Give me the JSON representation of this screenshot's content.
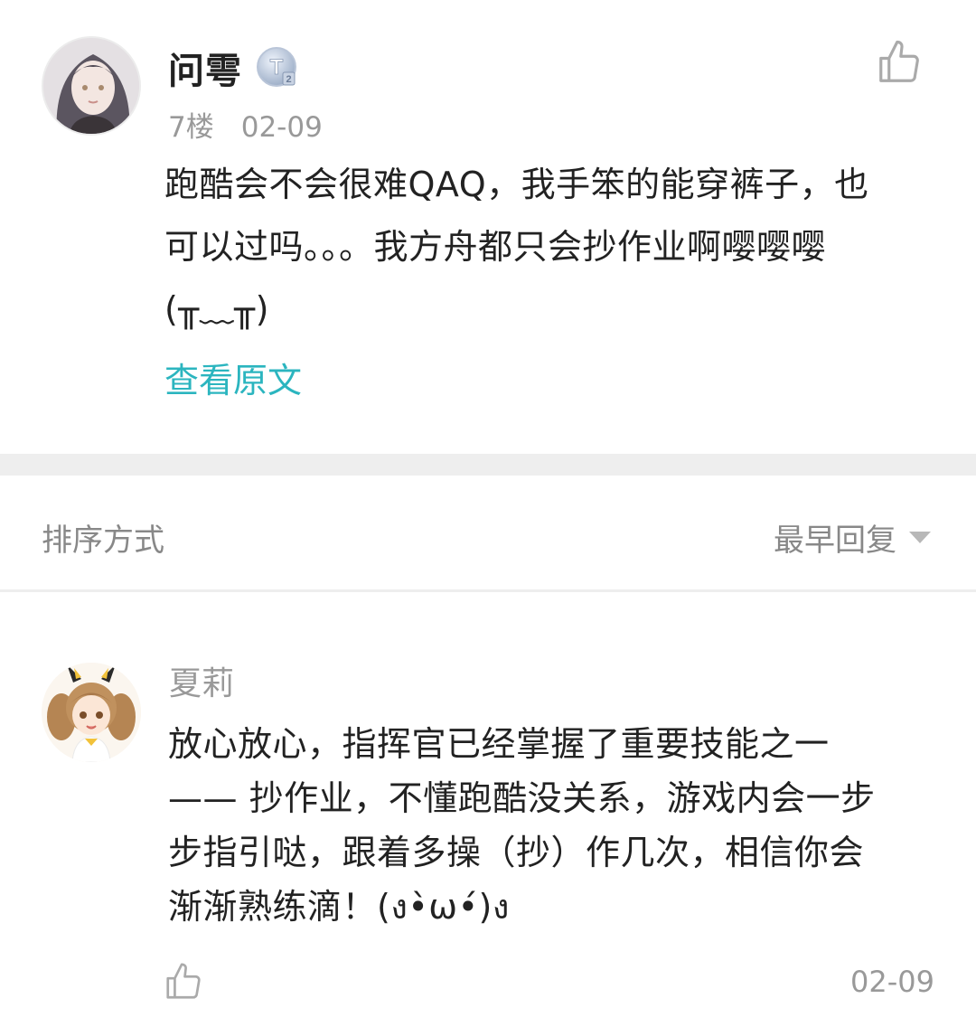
{
  "post": {
    "author": "问雩",
    "level_badge": "T2",
    "floor": "7楼",
    "date": "02-09",
    "body_lines": [
      "跑酷会不会很难QAQ，我手笨的能穿裤子，也",
      "可以过吗。。。我方舟都只会抄作业啊嘤嘤嘤",
      "(╥﹏╥)"
    ],
    "view_original": "查看原文",
    "like_icon": "thumbs-up-icon"
  },
  "sort": {
    "label": "排序方式",
    "selected": "最早回复",
    "caret_icon": "caret-down-icon"
  },
  "reply": {
    "author": "夏莉",
    "body_lines": [
      "放心放心，指挥官已经掌握了重要技能之一",
      "—— 抄作业，不懂跑酷没关系，游戏内会一步",
      "步指引哒，跟着多操（抄）作几次，相信你会",
      "渐渐熟练滴！(ง•̀ω•́)ง"
    ],
    "date": "02-09",
    "like_icon": "thumbs-up-icon"
  },
  "colors": {
    "accent_link": "#2bb5bf",
    "meta_gray": "#999999",
    "divider_gray": "#eeeeee"
  }
}
